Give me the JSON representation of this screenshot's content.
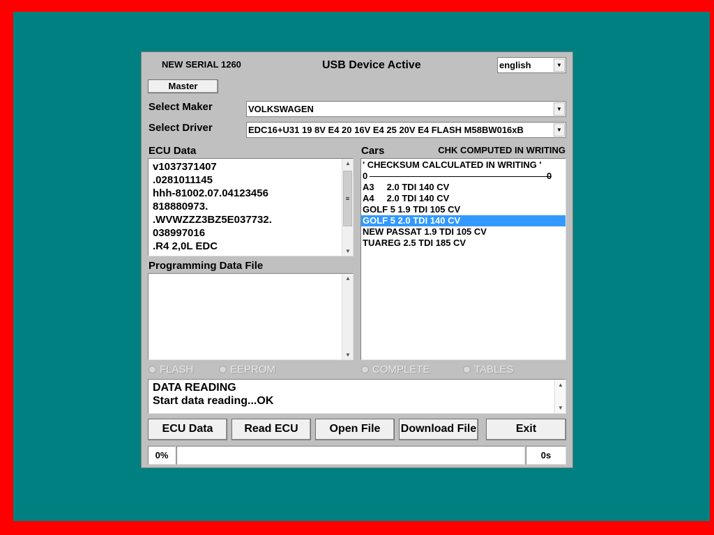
{
  "header": {
    "serial": "NEW SERIAL 1260",
    "status": "USB Device Active",
    "language": "english",
    "master": "Master"
  },
  "maker": {
    "label": "Select Maker",
    "value": "VOLKSWAGEN"
  },
  "driver": {
    "label": "Select Driver",
    "value": "EDC16+U31  19 8V E4  20 16V E4 25 20V E4 FLASH M58BW016xB"
  },
  "ecu": {
    "label": "ECU Data",
    "lines": [
      "v1037371407",
      ".0281011145",
      "hhh-81002.07.04123456",
      "818880973.",
      ".WVWZZZ3BZ5E037732.",
      "038997016",
      ".R4 2,0L EDC"
    ]
  },
  "prog": {
    "label": "Programming Data File"
  },
  "cars": {
    "label": "Cars",
    "note": "CHK COMPUTED IN WRITING",
    "items": [
      "' CHECKSUM CALCULATED IN WRITING '",
      "A3     2.0 TDI 140 CV",
      "A4     2.0 TDI 140 CV",
      "GOLF 5 1.9 TDI 105 CV",
      "GOLF 5 2.0 TDI 140 CV",
      "NEW PASSAT 1.9 TDI 105 CV",
      "TUAREG 2.5 TDI 185 CV"
    ],
    "divider_left": "0",
    "divider_right": "0",
    "selected": "GOLF 5 2.0 TDI 140 CV"
  },
  "radios": {
    "flash": "FLASH",
    "eeprom": "EEPROM",
    "complete": "COMPLETE",
    "tables": "TABLES"
  },
  "log": {
    "lines": [
      "DATA READING",
      "Start data reading...OK"
    ]
  },
  "buttons": {
    "ecu_data": "ECU Data",
    "read_ecu": "Read ECU",
    "open_file": "Open File",
    "download_file": "Download File",
    "exit": "Exit"
  },
  "progress": {
    "percent": "0%",
    "time": "0s",
    "value": 0
  },
  "colors": {
    "selection": "#3399ff",
    "desktop": "#008080",
    "frame": "#ff0000"
  }
}
